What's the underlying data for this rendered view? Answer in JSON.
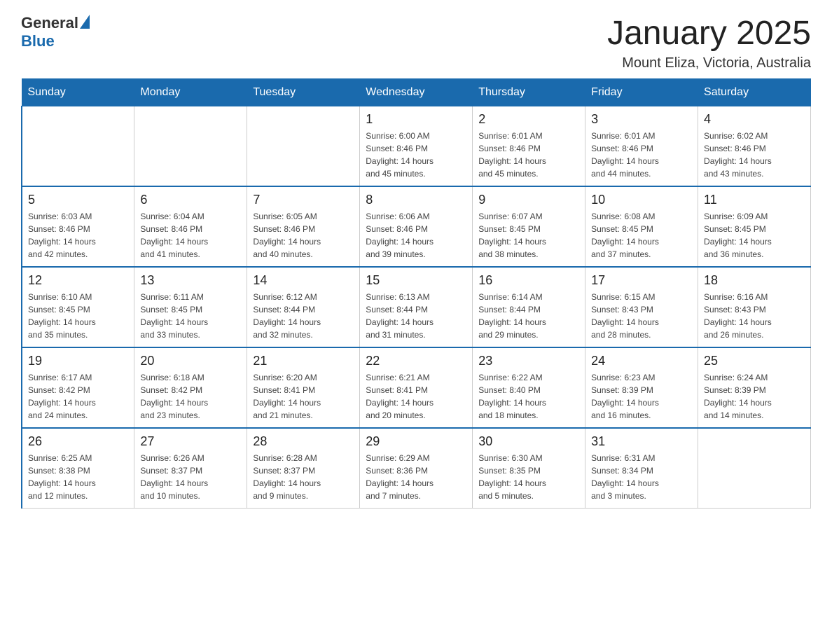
{
  "header": {
    "logo": {
      "general": "General",
      "blue": "Blue"
    },
    "title": "January 2025",
    "location": "Mount Eliza, Victoria, Australia"
  },
  "weekdays": [
    "Sunday",
    "Monday",
    "Tuesday",
    "Wednesday",
    "Thursday",
    "Friday",
    "Saturday"
  ],
  "weeks": [
    [
      {
        "day": "",
        "info": ""
      },
      {
        "day": "",
        "info": ""
      },
      {
        "day": "",
        "info": ""
      },
      {
        "day": "1",
        "info": "Sunrise: 6:00 AM\nSunset: 8:46 PM\nDaylight: 14 hours\nand 45 minutes."
      },
      {
        "day": "2",
        "info": "Sunrise: 6:01 AM\nSunset: 8:46 PM\nDaylight: 14 hours\nand 45 minutes."
      },
      {
        "day": "3",
        "info": "Sunrise: 6:01 AM\nSunset: 8:46 PM\nDaylight: 14 hours\nand 44 minutes."
      },
      {
        "day": "4",
        "info": "Sunrise: 6:02 AM\nSunset: 8:46 PM\nDaylight: 14 hours\nand 43 minutes."
      }
    ],
    [
      {
        "day": "5",
        "info": "Sunrise: 6:03 AM\nSunset: 8:46 PM\nDaylight: 14 hours\nand 42 minutes."
      },
      {
        "day": "6",
        "info": "Sunrise: 6:04 AM\nSunset: 8:46 PM\nDaylight: 14 hours\nand 41 minutes."
      },
      {
        "day": "7",
        "info": "Sunrise: 6:05 AM\nSunset: 8:46 PM\nDaylight: 14 hours\nand 40 minutes."
      },
      {
        "day": "8",
        "info": "Sunrise: 6:06 AM\nSunset: 8:46 PM\nDaylight: 14 hours\nand 39 minutes."
      },
      {
        "day": "9",
        "info": "Sunrise: 6:07 AM\nSunset: 8:45 PM\nDaylight: 14 hours\nand 38 minutes."
      },
      {
        "day": "10",
        "info": "Sunrise: 6:08 AM\nSunset: 8:45 PM\nDaylight: 14 hours\nand 37 minutes."
      },
      {
        "day": "11",
        "info": "Sunrise: 6:09 AM\nSunset: 8:45 PM\nDaylight: 14 hours\nand 36 minutes."
      }
    ],
    [
      {
        "day": "12",
        "info": "Sunrise: 6:10 AM\nSunset: 8:45 PM\nDaylight: 14 hours\nand 35 minutes."
      },
      {
        "day": "13",
        "info": "Sunrise: 6:11 AM\nSunset: 8:45 PM\nDaylight: 14 hours\nand 33 minutes."
      },
      {
        "day": "14",
        "info": "Sunrise: 6:12 AM\nSunset: 8:44 PM\nDaylight: 14 hours\nand 32 minutes."
      },
      {
        "day": "15",
        "info": "Sunrise: 6:13 AM\nSunset: 8:44 PM\nDaylight: 14 hours\nand 31 minutes."
      },
      {
        "day": "16",
        "info": "Sunrise: 6:14 AM\nSunset: 8:44 PM\nDaylight: 14 hours\nand 29 minutes."
      },
      {
        "day": "17",
        "info": "Sunrise: 6:15 AM\nSunset: 8:43 PM\nDaylight: 14 hours\nand 28 minutes."
      },
      {
        "day": "18",
        "info": "Sunrise: 6:16 AM\nSunset: 8:43 PM\nDaylight: 14 hours\nand 26 minutes."
      }
    ],
    [
      {
        "day": "19",
        "info": "Sunrise: 6:17 AM\nSunset: 8:42 PM\nDaylight: 14 hours\nand 24 minutes."
      },
      {
        "day": "20",
        "info": "Sunrise: 6:18 AM\nSunset: 8:42 PM\nDaylight: 14 hours\nand 23 minutes."
      },
      {
        "day": "21",
        "info": "Sunrise: 6:20 AM\nSunset: 8:41 PM\nDaylight: 14 hours\nand 21 minutes."
      },
      {
        "day": "22",
        "info": "Sunrise: 6:21 AM\nSunset: 8:41 PM\nDaylight: 14 hours\nand 20 minutes."
      },
      {
        "day": "23",
        "info": "Sunrise: 6:22 AM\nSunset: 8:40 PM\nDaylight: 14 hours\nand 18 minutes."
      },
      {
        "day": "24",
        "info": "Sunrise: 6:23 AM\nSunset: 8:39 PM\nDaylight: 14 hours\nand 16 minutes."
      },
      {
        "day": "25",
        "info": "Sunrise: 6:24 AM\nSunset: 8:39 PM\nDaylight: 14 hours\nand 14 minutes."
      }
    ],
    [
      {
        "day": "26",
        "info": "Sunrise: 6:25 AM\nSunset: 8:38 PM\nDaylight: 14 hours\nand 12 minutes."
      },
      {
        "day": "27",
        "info": "Sunrise: 6:26 AM\nSunset: 8:37 PM\nDaylight: 14 hours\nand 10 minutes."
      },
      {
        "day": "28",
        "info": "Sunrise: 6:28 AM\nSunset: 8:37 PM\nDaylight: 14 hours\nand 9 minutes."
      },
      {
        "day": "29",
        "info": "Sunrise: 6:29 AM\nSunset: 8:36 PM\nDaylight: 14 hours\nand 7 minutes."
      },
      {
        "day": "30",
        "info": "Sunrise: 6:30 AM\nSunset: 8:35 PM\nDaylight: 14 hours\nand 5 minutes."
      },
      {
        "day": "31",
        "info": "Sunrise: 6:31 AM\nSunset: 8:34 PM\nDaylight: 14 hours\nand 3 minutes."
      },
      {
        "day": "",
        "info": ""
      }
    ]
  ]
}
